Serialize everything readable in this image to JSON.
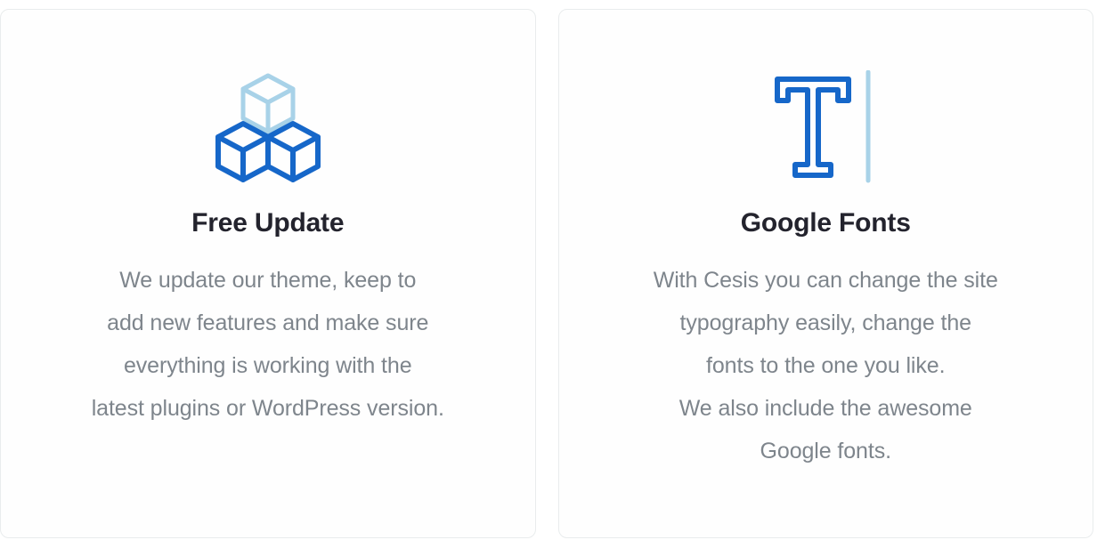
{
  "theme": {
    "page_background": "#ffffff",
    "card_background": "#fefefe",
    "card_border": "#e9eced",
    "title_color": "#23232d",
    "body_color": "#7e858c",
    "accent_blue": "#1667c9",
    "accent_light_blue": "#a8d2e8"
  },
  "cards": [
    {
      "icon_name": "stacked-cubes-icon",
      "title": "Free Update",
      "body_lines": [
        "We update our theme, keep to",
        "add new features and make sure",
        "everything is working with the",
        "latest plugins or WordPress version."
      ]
    },
    {
      "icon_name": "typography-letter-t-icon",
      "title": "Google Fonts",
      "body_lines": [
        "With Cesis you can change the site",
        "typography easily, change the",
        "fonts to the one you like.",
        "We also include the awesome",
        "Google fonts."
      ]
    }
  ]
}
